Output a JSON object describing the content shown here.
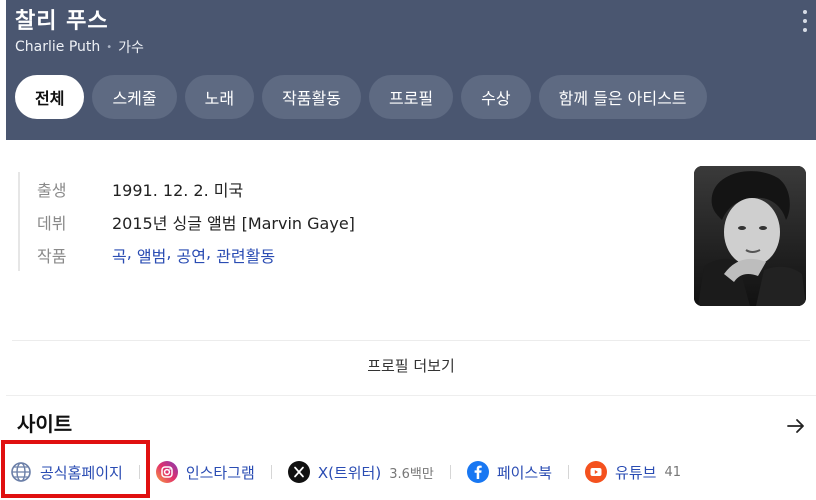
{
  "header": {
    "title": "찰리 푸스",
    "name_en": "Charlie Puth",
    "role": "가수",
    "separator": "•"
  },
  "tabs": [
    {
      "label": "전체",
      "active": true
    },
    {
      "label": "스케줄",
      "active": false
    },
    {
      "label": "노래",
      "active": false
    },
    {
      "label": "작품활동",
      "active": false
    },
    {
      "label": "프로필",
      "active": false
    },
    {
      "label": "수상",
      "active": false
    },
    {
      "label": "함께 들은 아티스트",
      "active": false
    }
  ],
  "profile": {
    "birth_label": "출생",
    "birth_value": "1991. 12. 2. 미국",
    "debut_label": "데뷔",
    "debut_value": "2015년 싱글 앨범 [Marvin Gaye]",
    "works_label": "작품",
    "works_links": [
      "곡",
      "앨범",
      "공연",
      "관련활동"
    ],
    "works_separator": ", ",
    "more_label": "프로필 더보기"
  },
  "sites": {
    "title": "사이트",
    "items": [
      {
        "label": "공식홈페이지",
        "icon": "globe-icon",
        "count": ""
      },
      {
        "label": "인스타그램",
        "icon": "instagram-icon",
        "count": ""
      },
      {
        "label": "X(트위터)",
        "icon": "x-twitter-icon",
        "count": "3.6백만"
      },
      {
        "label": "페이스북",
        "icon": "facebook-icon",
        "count": ""
      },
      {
        "label": "유튜브",
        "icon": "youtube-icon",
        "count": "41"
      }
    ]
  },
  "colors": {
    "header_bg": "#4a5670",
    "tab_bg": "#5e6a82",
    "link": "#2a4cb3",
    "highlight": "#e01010",
    "instagram": "#c13584",
    "facebook": "#1877f2",
    "youtube": "#f4511e"
  }
}
